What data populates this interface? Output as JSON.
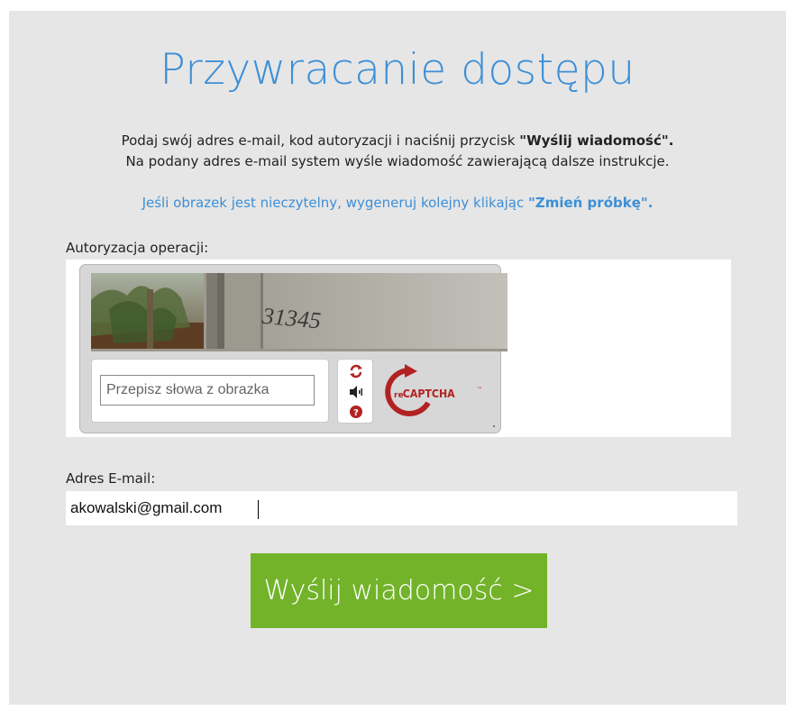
{
  "page": {
    "title": "Przywracanie dostępu",
    "intro_line1_text": "Podaj swój adres e-mail, kod autoryzacji i naciśnij przycisk ",
    "intro_line1_bold": "\"Wyślij wiadomość\".",
    "intro_line2": "Na podany adres e-mail system wyśle wiadomość zawierającą dalsze instrukcje.",
    "hint_text": "Jeśli obrazek jest nieczytelny, wygeneruj kolejny klikając ",
    "hint_bold": "\"Zmień próbkę\".",
    "auth_label": "Autoryzacja operacji:",
    "email_label": "Adres E-mail:",
    "submit_label": "Wyślij wiadomość >"
  },
  "captcha": {
    "image_text": "31345",
    "input_placeholder": "Przepisz słowa z obrazka",
    "input_value": "",
    "logo_prefix": "re",
    "logo_text": "CAPTCHA",
    "logo_tm": "™",
    "reload_icon": "reload-icon",
    "audio_icon": "audio-icon",
    "help_icon": "help-icon"
  },
  "form": {
    "email_value": "akowalski@gmail.com"
  },
  "colors": {
    "accent_blue": "#3d8fd6",
    "button_green": "#72b32a",
    "panel_bg": "#e6e6e6",
    "recaptcha_red": "#b22222"
  }
}
